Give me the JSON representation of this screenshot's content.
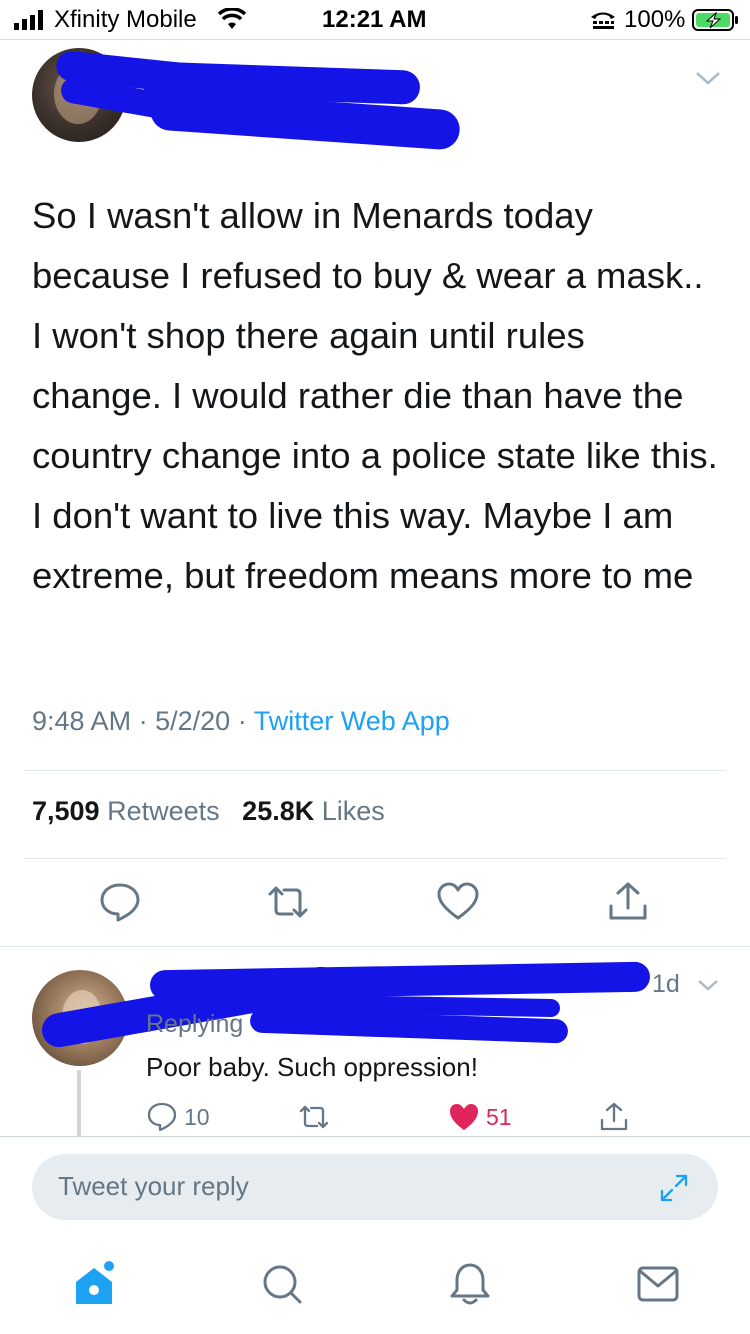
{
  "status_bar": {
    "carrier": "Xfinity Mobile",
    "time": "12:21 AM",
    "battery": "100%",
    "icons": [
      "signal-bars-icon",
      "wifi-icon",
      "tty-icon",
      "battery-charging-icon"
    ]
  },
  "tweet": {
    "text": "So I wasn't allow in Menards today because I refused to buy & wear a mask.. I won't shop there again until rules change. I would rather die than have the country change into a police state like this. I don't want to live this way. Maybe I am extreme, but freedom means more to me",
    "time": "9:48 AM",
    "date": "5/2/20",
    "separator": "·",
    "source": "Twitter Web App",
    "retweets_count": "7,509",
    "retweets_label": "Retweets",
    "likes_count": "25.8K",
    "likes_label": "Likes",
    "actions": [
      "reply-icon",
      "retweet-icon",
      "like-icon",
      "share-icon"
    ]
  },
  "reply": {
    "time": "1d",
    "replying_to": "Replying",
    "text": "Poor baby. Such oppression!",
    "reply_count": "10",
    "like_count": "51"
  },
  "compose": {
    "placeholder": "Tweet your reply"
  },
  "colors": {
    "accent": "#1da1f2",
    "like": "#e0245e",
    "muted": "#657786",
    "redaction": "#1414e6"
  },
  "bottom_nav": [
    "home-icon",
    "search-icon",
    "notifications-icon",
    "messages-icon"
  ]
}
